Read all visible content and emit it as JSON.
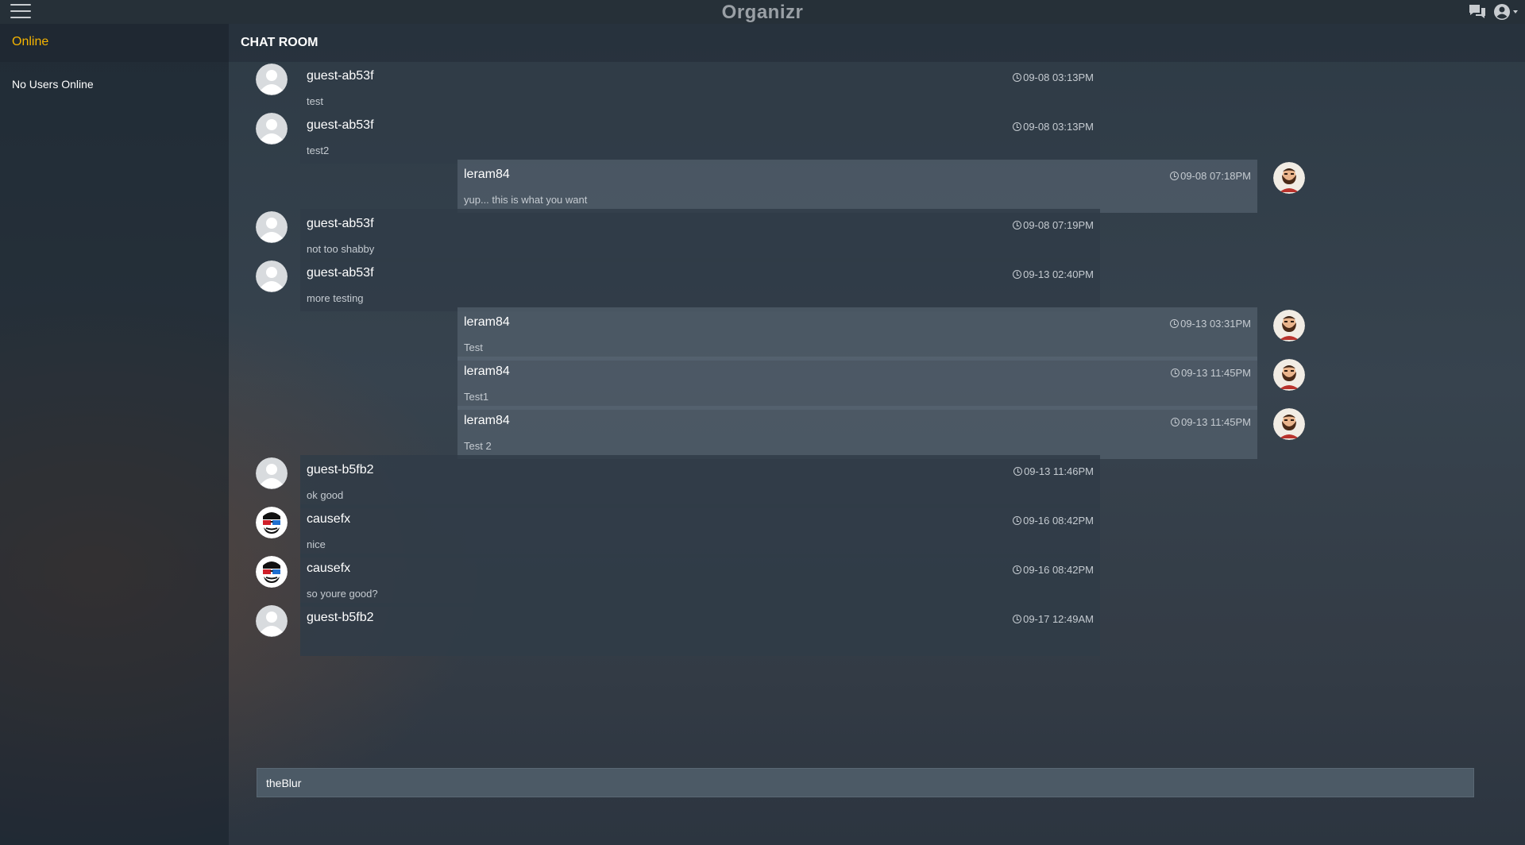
{
  "header": {
    "title": "Organizr",
    "menu_icon": "hamburger-icon",
    "chat_icon": "chat-bubbles-icon",
    "user_icon": "user-circle-icon"
  },
  "sidebar": {
    "heading": "Online",
    "empty_text": "No Users Online"
  },
  "main": {
    "heading": "CHAT ROOM"
  },
  "messages": [
    {
      "user": "guest-ab53f",
      "text": "test",
      "time": "09-08 03:13PM",
      "side": "left",
      "avatar": "default-avatar-icon"
    },
    {
      "user": "guest-ab53f",
      "text": "test2",
      "time": "09-08 03:13PM",
      "side": "left",
      "avatar": "default-avatar-icon"
    },
    {
      "user": "leram84",
      "text": "yup... this is what you want",
      "time": "09-08 07:18PM",
      "side": "right",
      "avatar": "bearded-man-avatar-icon"
    },
    {
      "user": "guest-ab53f",
      "text": "not too shabby",
      "time": "09-08 07:19PM",
      "side": "left",
      "avatar": "default-avatar-icon"
    },
    {
      "user": "guest-ab53f",
      "text": "more testing",
      "time": "09-13 02:40PM",
      "side": "left",
      "avatar": "default-avatar-icon"
    },
    {
      "user": "leram84",
      "text": "Test",
      "time": "09-13 03:31PM",
      "side": "right",
      "avatar": "bearded-man-avatar-icon"
    },
    {
      "user": "leram84",
      "text": "Test1",
      "time": "09-13 11:45PM",
      "side": "right",
      "avatar": "bearded-man-avatar-icon"
    },
    {
      "user": "leram84",
      "text": "Test 2",
      "time": "09-13 11:45PM",
      "side": "right",
      "avatar": "bearded-man-avatar-icon"
    },
    {
      "user": "guest-b5fb2",
      "text": "ok good",
      "time": "09-13 11:46PM",
      "side": "left",
      "avatar": "default-avatar-icon"
    },
    {
      "user": "causefx",
      "text": "nice",
      "time": "09-16 08:42PM",
      "side": "left",
      "avatar": "3d-glasses-avatar-icon"
    },
    {
      "user": "causefx",
      "text": "so youre good?",
      "time": "09-16 08:42PM",
      "side": "left",
      "avatar": "3d-glasses-avatar-icon"
    },
    {
      "user": "guest-b5fb2",
      "text": "",
      "time": "09-17 12:49AM",
      "side": "left",
      "avatar": "default-avatar-icon"
    }
  ],
  "composer": {
    "value": "theBlur"
  }
}
